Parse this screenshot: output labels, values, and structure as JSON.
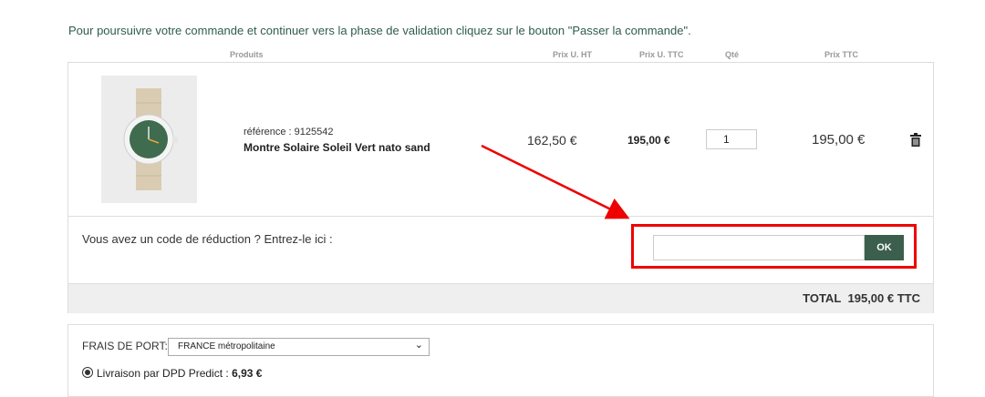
{
  "intro": "Pour poursuivre votre commande et continuer vers la phase de validation cliquez sur le bouton \"Passer la commande\".",
  "columns": {
    "products": "Produits",
    "unit_ht": "Prix U. HT",
    "unit_ttc": "Prix U. TTC",
    "qty": "Qté",
    "total_ttc": "Prix TTC"
  },
  "item": {
    "reference": "référence : 9125542",
    "name": "Montre Solaire Soleil Vert nato sand",
    "price_ht": "162,50 €",
    "price_ttc": "195,00 €",
    "quantity": "1",
    "line_total": "195,00 €",
    "image_icon": "watch-product-image",
    "delete_icon": "trash-icon"
  },
  "promo": {
    "label": "Vous avez un code de réduction ? Entrez-le ici :",
    "input_value": "",
    "button": "OK"
  },
  "total": {
    "label": "TOTAL",
    "amount": "195,00 € TTC"
  },
  "shipping": {
    "label": "FRAIS DE PORT:",
    "selected": "FRANCE métropolitaine",
    "option_text": "Livraison par DPD Predict : ",
    "option_price": "6,93 €"
  },
  "colors": {
    "brand_green": "#3b5f4c",
    "annotation_red": "#e00000"
  }
}
